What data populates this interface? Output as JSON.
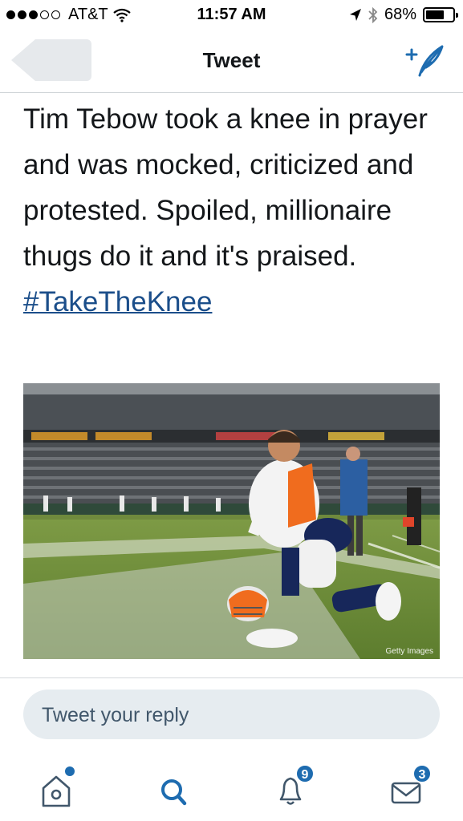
{
  "status_bar": {
    "carrier": "AT&T",
    "time": "11:57 AM",
    "battery": "68%",
    "battery_level": 0.68,
    "signal_bars_filled": 3,
    "signal_bars_total": 5
  },
  "nav": {
    "title": "Tweet",
    "compose_icon": "compose-tweet-icon"
  },
  "tweet": {
    "text": "Tim Tebow took a knee in prayer and was mocked, criticized and protested. Spoiled, millionaire thugs do it and it's praised.",
    "hashtag": "#TakeTheKnee",
    "photo_credit": "Getty Images"
  },
  "reply": {
    "placeholder": "Tweet your reply"
  },
  "tabbar": {
    "notifications_badge": "9",
    "messages_badge": "3"
  },
  "colors": {
    "accent": "#1e6cb0",
    "hashtag": "#1b4e8a",
    "reply_bg": "#e6ecf0"
  }
}
